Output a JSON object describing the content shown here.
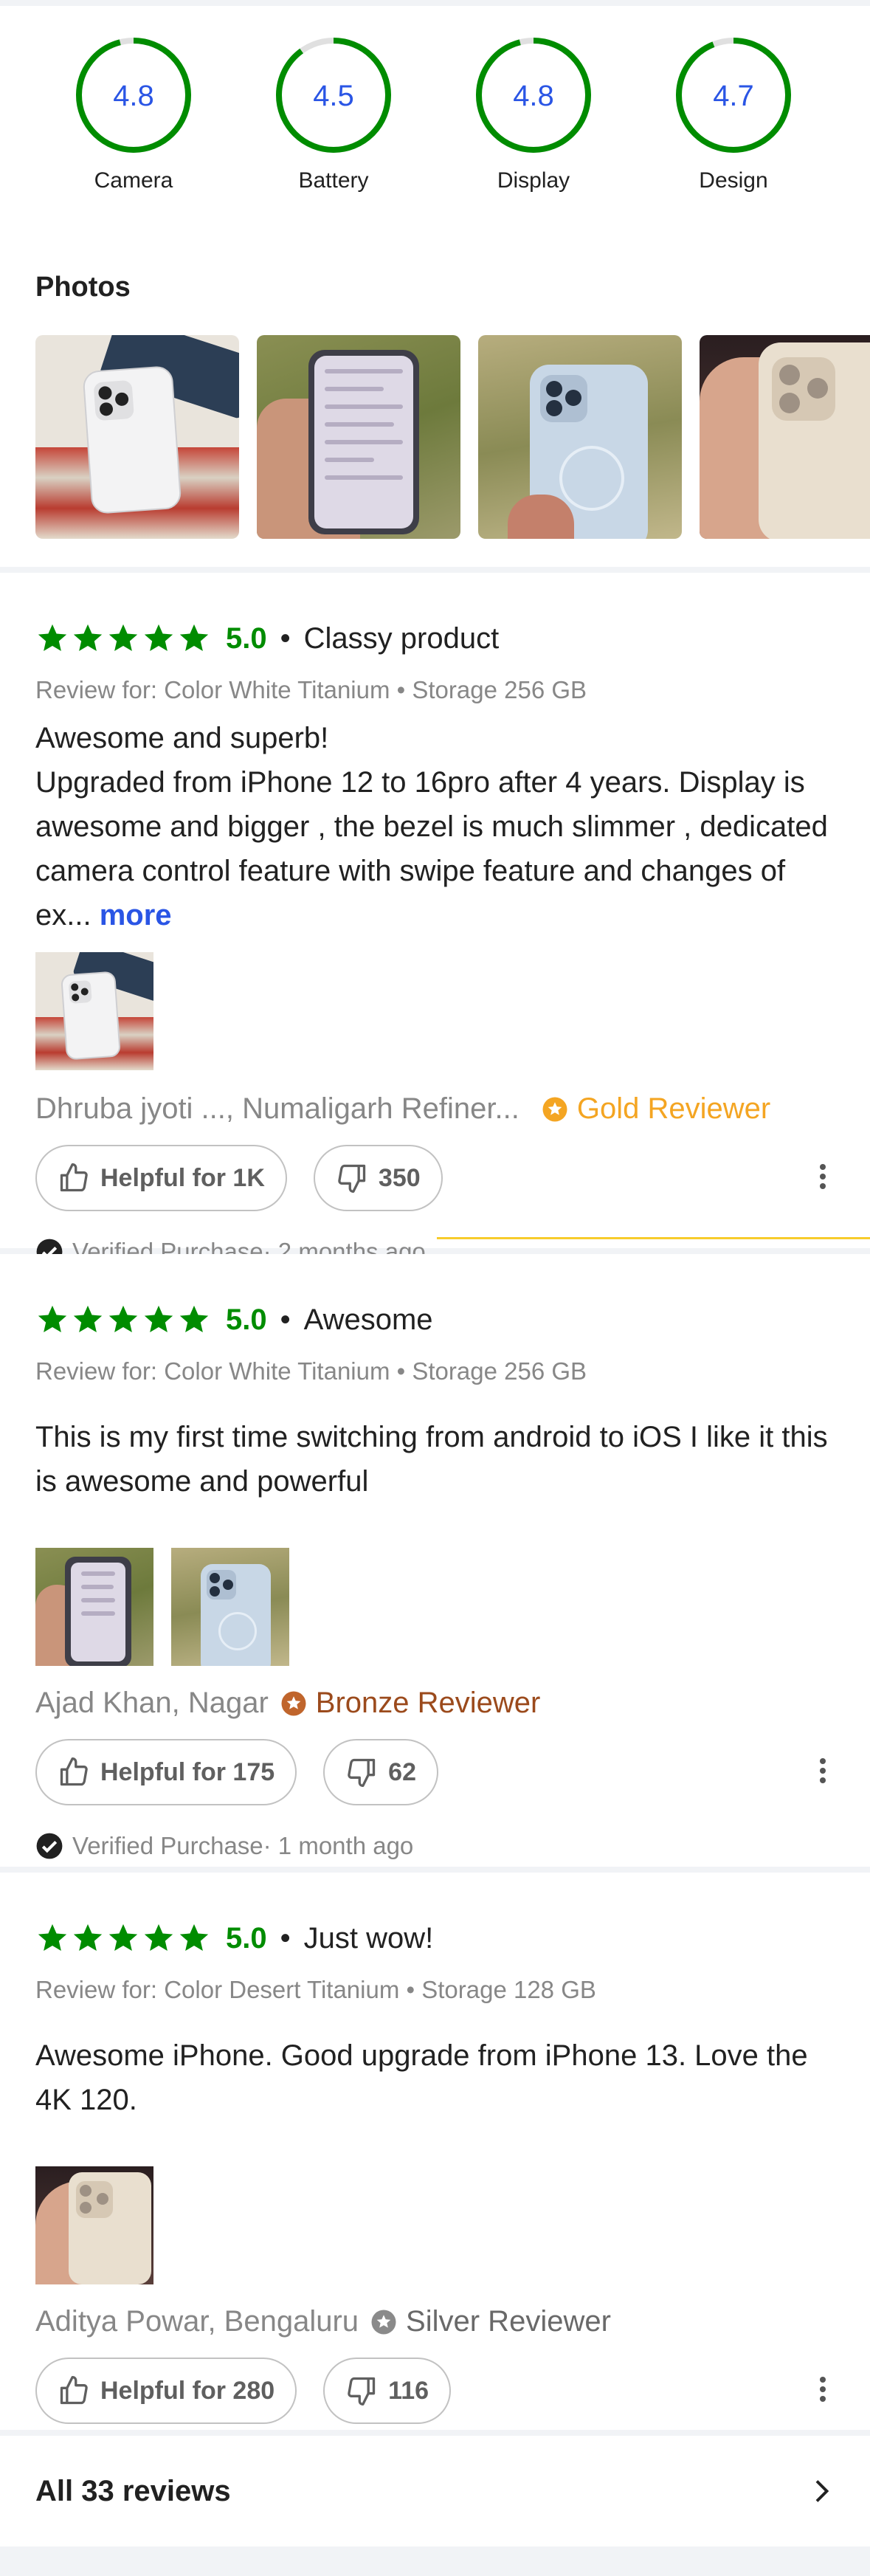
{
  "rating_breakdown": [
    {
      "label": "Camera",
      "value": "4.8",
      "fraction": 0.96
    },
    {
      "label": "Battery",
      "value": "4.5",
      "fraction": 0.9
    },
    {
      "label": "Display",
      "value": "4.8",
      "fraction": 0.96
    },
    {
      "label": "Design",
      "value": "4.7",
      "fraction": 0.94
    }
  ],
  "colors": {
    "ring_fill": "#008c00",
    "ring_track": "#e0e0e0",
    "ring_text": "#2a55e5",
    "star": "#008c00",
    "link": "#2a55e5"
  },
  "photos": {
    "title": "Photos",
    "count_visible": 4
  },
  "reviews": [
    {
      "rating": "5.0",
      "dot": "•",
      "title": "Classy product",
      "review_for": "Review for: Color White Titanium • Storage 256 GB",
      "text": "Awesome and superb!\nUpgraded from iPhone 12 to 16pro after 4 years. Display is awesome and bigger , the bezel is much slimmer , dedicated camera control feature  with swipe feature and changes of ex...",
      "more": " more",
      "reviewer": "Dhruba jyoti ..., Numaligarh Refiner...",
      "badge": "Gold Reviewer",
      "helpful": "Helpful for 1K",
      "dislikes": "350",
      "verified": "Verified Purchase· 2 months ago"
    },
    {
      "rating": "5.0",
      "dot": "•",
      "title": "Awesome",
      "review_for": "Review for: Color White Titanium • Storage 256 GB",
      "text": "This is my first time switching from android to iOS I like it this is awesome and powerful",
      "reviewer": "Ajad Khan, Nagar",
      "badge": "Bronze Reviewer",
      "helpful": "Helpful for 175",
      "dislikes": "62",
      "verified": "Verified Purchase· 1 month ago"
    },
    {
      "rating": "5.0",
      "dot": "•",
      "title": "Just wow!",
      "review_for": "Review for: Color Desert Titanium • Storage 128 GB",
      "text": "Awesome iPhone. Good upgrade from iPhone 13. Love the 4K 120.",
      "reviewer": "Aditya Powar, Bengaluru",
      "badge": "Silver Reviewer",
      "helpful": "Helpful for 280",
      "dislikes": "116"
    }
  ],
  "footer": {
    "all_reviews": "All 33 reviews"
  },
  "icons": [
    "star-icon",
    "thumbs-up-icon",
    "thumbs-down-icon",
    "more-vertical-icon",
    "verified-check-icon",
    "reviewer-badge-icon",
    "chevron-right-icon"
  ]
}
